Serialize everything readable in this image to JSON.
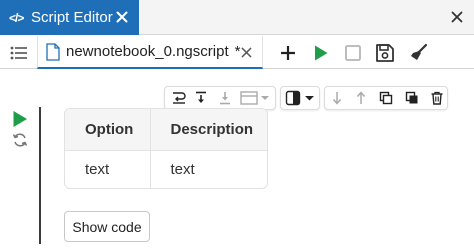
{
  "window": {
    "tab_title": "Script Editor",
    "tab_icon": "code-icon",
    "colors": {
      "accent": "#1f6fb8",
      "run_green": "#1e9e48"
    }
  },
  "file_tabs": [
    {
      "name": "newnotebook_0.ngscript",
      "modified_marker": "*",
      "active": true
    }
  ],
  "toolbar": {
    "icons": [
      "add-icon",
      "run-icon",
      "stop-icon",
      "save-icon",
      "clear-icon"
    ]
  },
  "cell_toolbar": {
    "icons": [
      "wrap-icon",
      "insert-below-icon",
      "insert-above-icon",
      "cell-type-icon",
      "theme-toggle-icon",
      "move-down-icon",
      "move-up-icon",
      "copy-icon",
      "duplicate-icon",
      "delete-icon"
    ]
  },
  "result_table": {
    "columns": [
      "Option",
      "Description"
    ],
    "rows": [
      [
        "text",
        "text"
      ]
    ]
  },
  "show_code_label": "Show code"
}
